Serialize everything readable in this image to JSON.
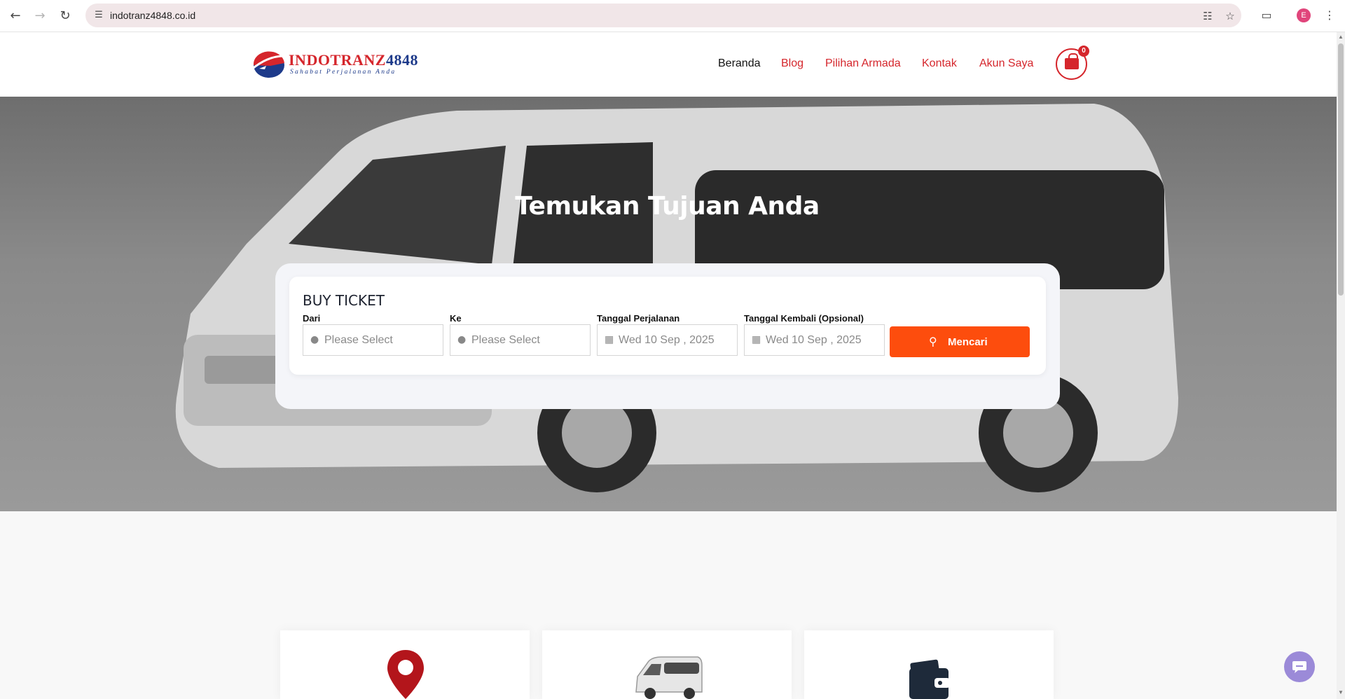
{
  "browser": {
    "url": "indotranz4848.co.id",
    "profile_initial": "E"
  },
  "site": {
    "logo": {
      "name_red": "INDOTRANZ",
      "name_blue": "4848",
      "tagline": "Sahabat Perjalanan Anda"
    },
    "menu": [
      {
        "label": "Beranda",
        "active": true
      },
      {
        "label": "Blog",
        "active": false
      },
      {
        "label": "Pilihan Armada",
        "active": false
      },
      {
        "label": "Kontak",
        "active": false
      },
      {
        "label": "Akun Saya",
        "active": false
      }
    ],
    "cart_count": "0"
  },
  "hero": {
    "title": "Temukan Tujuan Anda"
  },
  "search": {
    "card_title": "BUY TICKET",
    "from": {
      "label": "Dari",
      "value": "Please Select"
    },
    "to": {
      "label": "Ke",
      "value": "Please Select"
    },
    "depart": {
      "label": "Tanggal Perjalanan",
      "value": "Wed 10 Sep , 2025"
    },
    "return": {
      "label": "Tanggal Kembali (Opsional)",
      "value": "Wed 10 Sep , 2025"
    },
    "button_label": "Mencari"
  },
  "colors": {
    "brand_red": "#d5262c",
    "brand_blue": "#1d3a8a",
    "search_button": "#fd4d0d"
  },
  "features": [
    {
      "icon": "map-pin-icon"
    },
    {
      "icon": "van-icon"
    },
    {
      "icon": "wallet-icon"
    }
  ]
}
